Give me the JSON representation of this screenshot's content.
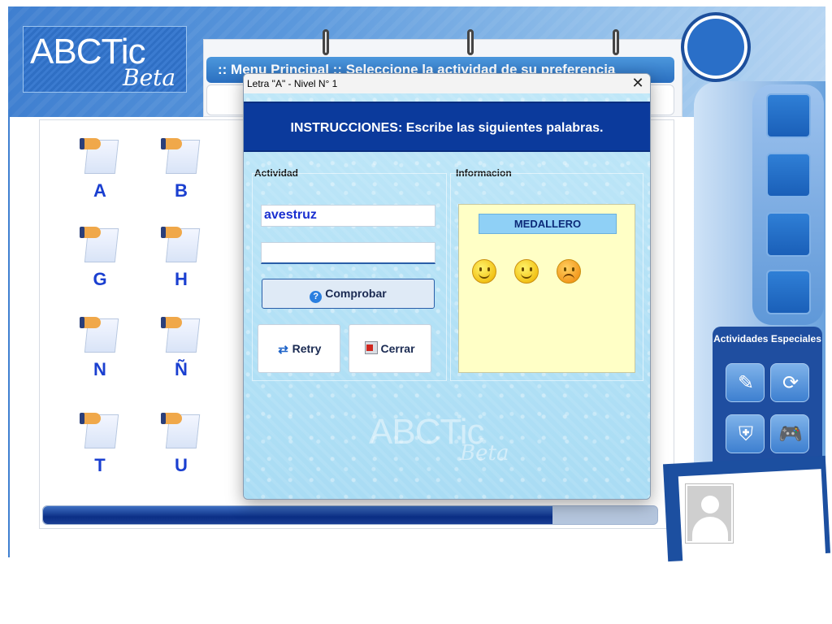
{
  "app": {
    "logo_main": "ABCTic",
    "logo_sub": "Beta",
    "menu_title": ":: Menu Principal ::  Seleccione la actividad de su preferencia",
    "letters": [
      "A",
      "B",
      "G",
      "H",
      "N",
      "Ñ",
      "T",
      "U"
    ],
    "progress_fraction": 0.83,
    "special_title": "Actividades Especiales",
    "special_icons": [
      "edit-icon",
      "refresh-icon",
      "security-agent-icon",
      "gamepad-icon"
    ]
  },
  "dialog": {
    "title": "Letra \"A\" - Nivel N° 1",
    "close_glyph": "✕",
    "instructions": "INSTRUCCIONES: Escribe las siguientes palabras.",
    "activity_label": "Actividad",
    "info_label": "Informacion",
    "word": "avestruz",
    "answer_value": "",
    "check_label": "Comprobar",
    "retry_label": "Retry",
    "close_label": "Cerrar",
    "medal_header": "MEDALLERO",
    "medals": [
      "happy",
      "happy",
      "sad"
    ],
    "watermark_main": "ABCTic",
    "watermark_sub": "Beta"
  },
  "colors": {
    "accent": "#0b3a9c",
    "letter": "#1a3fd0",
    "medal_bg": "#ffffc6"
  }
}
